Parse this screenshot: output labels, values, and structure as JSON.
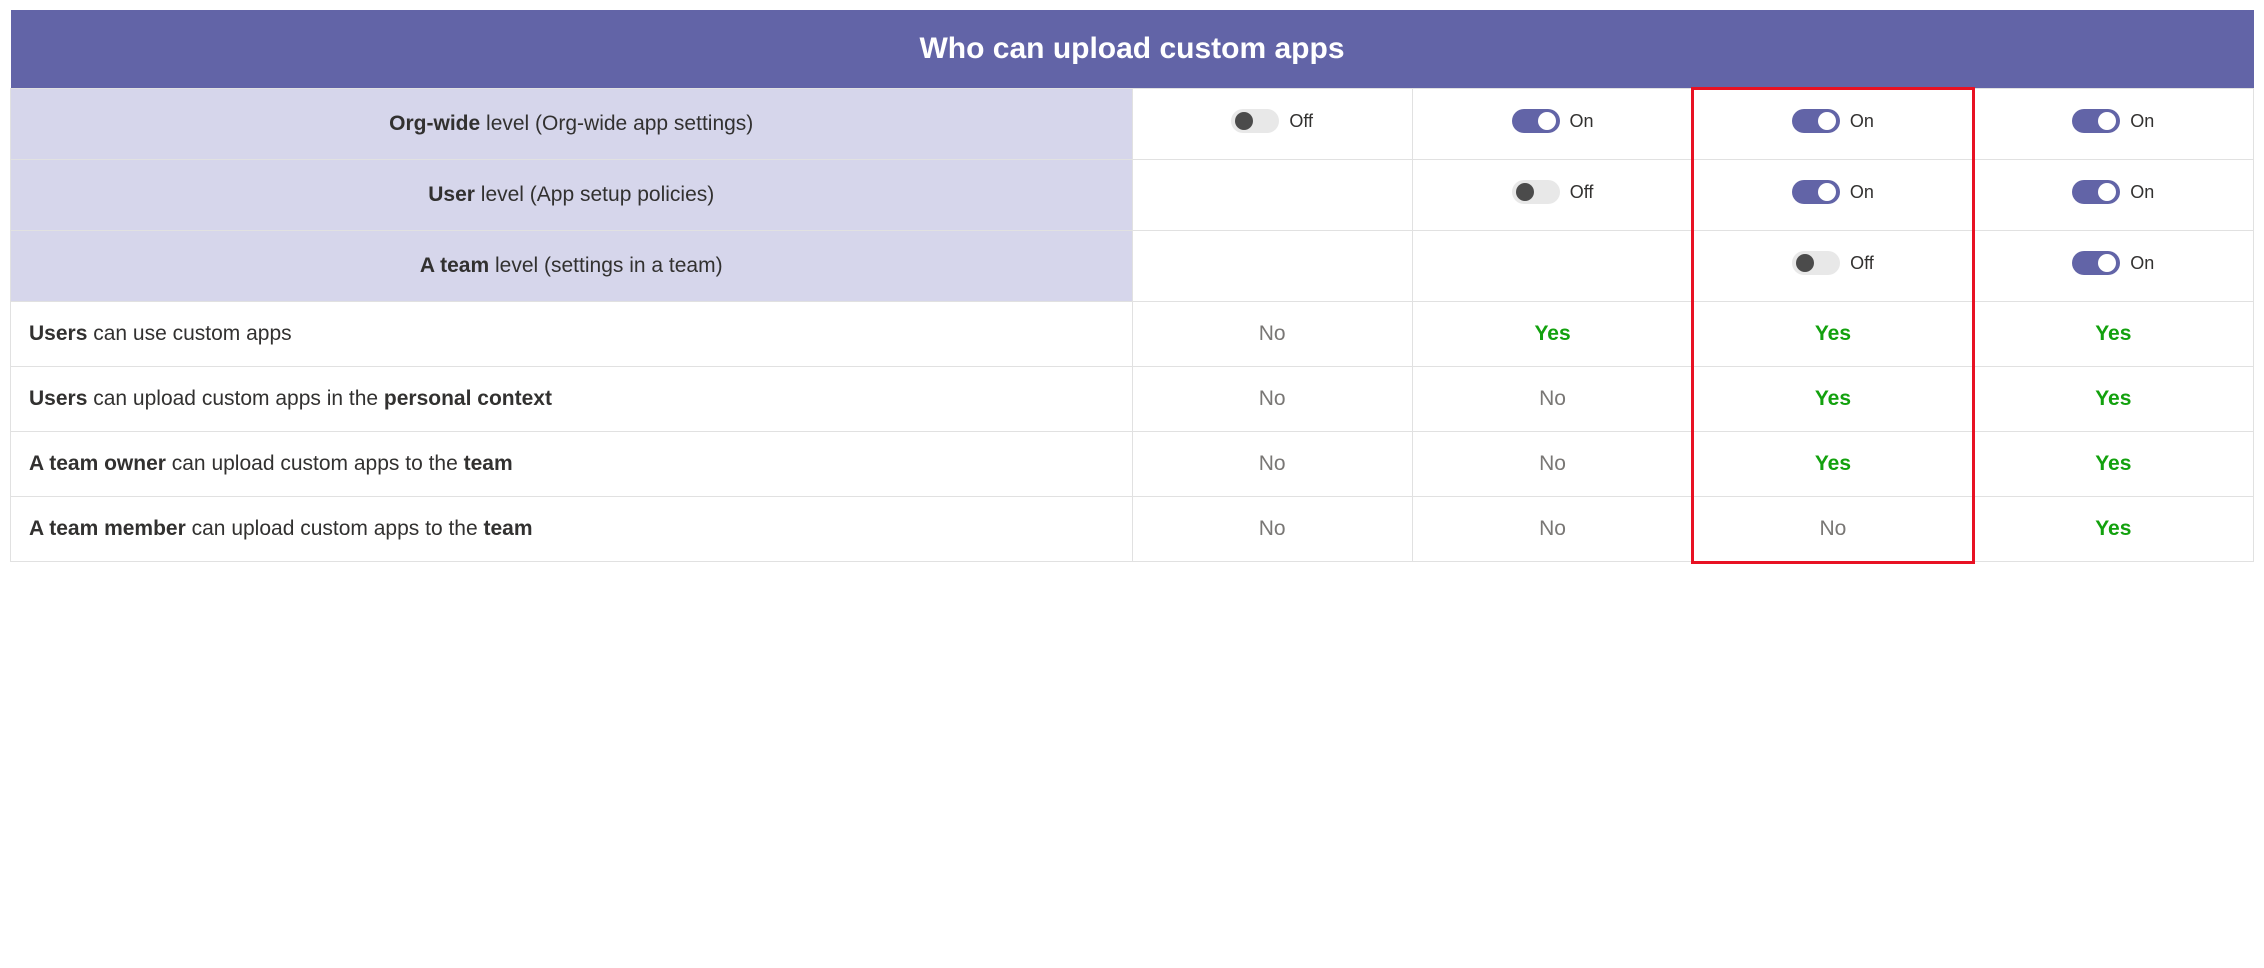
{
  "title": "Who can upload custom apps",
  "labels": {
    "on": "On",
    "off": "Off"
  },
  "settings": [
    {
      "bold": "Org-wide",
      "rest": " level (Org-wide app settings)",
      "cols": [
        "off",
        "on",
        "on",
        "on"
      ]
    },
    {
      "bold": "User",
      "rest": " level (App setup policies)",
      "cols": [
        "",
        "off",
        "on",
        "on"
      ]
    },
    {
      "bold": "A team",
      "rest": " level (settings in a team)",
      "cols": [
        "",
        "",
        "off",
        "on"
      ]
    }
  ],
  "results": [
    {
      "segments": [
        [
          "b",
          "Users"
        ],
        [
          "",
          " can use custom apps"
        ]
      ],
      "cols": [
        "No",
        "Yes",
        "Yes",
        "Yes"
      ]
    },
    {
      "segments": [
        [
          "b",
          "Users"
        ],
        [
          "",
          " can upload custom apps in the "
        ],
        [
          "b",
          "personal context"
        ]
      ],
      "cols": [
        "No",
        "No",
        "Yes",
        "Yes"
      ]
    },
    {
      "segments": [
        [
          "b",
          "A team owner"
        ],
        [
          "",
          " can upload custom apps to the "
        ],
        [
          "b",
          "team"
        ]
      ],
      "cols": [
        "No",
        "No",
        "Yes",
        "Yes"
      ]
    },
    {
      "segments": [
        [
          "b",
          "A team member"
        ],
        [
          "",
          " can upload custom apps to the "
        ],
        [
          "b",
          "team"
        ]
      ],
      "cols": [
        "No",
        "No",
        "No",
        "Yes"
      ]
    }
  ],
  "highlight_column_index": 2,
  "chart_data": {
    "type": "table",
    "title": "Who can upload custom apps",
    "setting_rows": [
      "Org-wide level (Org-wide app settings)",
      "User level (App setup policies)",
      "A team level (settings in a team)"
    ],
    "result_rows": [
      "Users can use custom apps",
      "Users can upload custom apps in the personal context",
      "A team owner can upload custom apps to the team",
      "A team member can upload custom apps to the team"
    ],
    "scenarios": [
      {
        "settings": {
          "org_wide": "Off",
          "user": null,
          "team": null
        },
        "results": [
          "No",
          "No",
          "No",
          "No"
        ]
      },
      {
        "settings": {
          "org_wide": "On",
          "user": "Off",
          "team": null
        },
        "results": [
          "Yes",
          "No",
          "No",
          "No"
        ]
      },
      {
        "settings": {
          "org_wide": "On",
          "user": "On",
          "team": "Off"
        },
        "results": [
          "Yes",
          "Yes",
          "Yes",
          "No"
        ],
        "highlighted": true
      },
      {
        "settings": {
          "org_wide": "On",
          "user": "On",
          "team": "On"
        },
        "results": [
          "Yes",
          "Yes",
          "Yes",
          "Yes"
        ]
      }
    ]
  }
}
